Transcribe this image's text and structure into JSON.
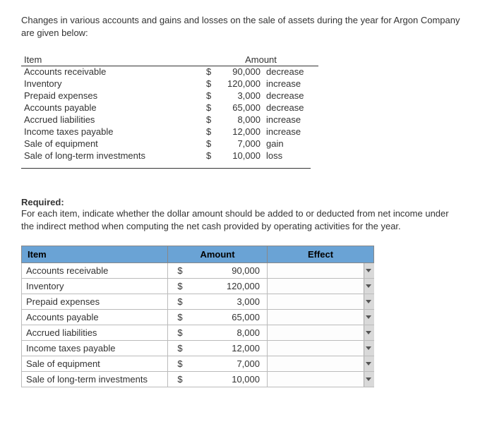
{
  "intro": "Changes in various accounts and gains and losses on the sale of assets during the year for Argon Company are given below:",
  "given": {
    "headers": {
      "item": "Item",
      "amount": "Amount"
    },
    "rows": [
      {
        "item": "Accounts receivable",
        "sign": "$",
        "value": "90,000",
        "direction": "decrease"
      },
      {
        "item": "Inventory",
        "sign": "$",
        "value": "120,000",
        "direction": "increase"
      },
      {
        "item": "Prepaid expenses",
        "sign": "$",
        "value": "3,000",
        "direction": "decrease"
      },
      {
        "item": "Accounts payable",
        "sign": "$",
        "value": "65,000",
        "direction": "decrease"
      },
      {
        "item": "Accrued liabilities",
        "sign": "$",
        "value": "8,000",
        "direction": "increase"
      },
      {
        "item": "Income taxes payable",
        "sign": "$",
        "value": "12,000",
        "direction": "increase"
      },
      {
        "item": "Sale of equipment",
        "sign": "$",
        "value": "7,000",
        "direction": "gain"
      },
      {
        "item": "Sale of long-term investments",
        "sign": "$",
        "value": "10,000",
        "direction": "loss"
      }
    ]
  },
  "required": {
    "heading": "Required:",
    "text": "For each item, indicate whether the dollar amount should be added to or deducted from net income under the indirect method when computing the net cash provided by operating activities for the year."
  },
  "answer": {
    "headers": {
      "item": "Item",
      "amount": "Amount",
      "effect": "Effect"
    },
    "rows": [
      {
        "item": "Accounts receivable",
        "sign": "$",
        "value": "90,000",
        "effect": ""
      },
      {
        "item": "Inventory",
        "sign": "$",
        "value": "120,000",
        "effect": ""
      },
      {
        "item": "Prepaid expenses",
        "sign": "$",
        "value": "3,000",
        "effect": ""
      },
      {
        "item": "Accounts payable",
        "sign": "$",
        "value": "65,000",
        "effect": ""
      },
      {
        "item": "Accrued liabilities",
        "sign": "$",
        "value": "8,000",
        "effect": ""
      },
      {
        "item": "Income taxes payable",
        "sign": "$",
        "value": "12,000",
        "effect": ""
      },
      {
        "item": "Sale of equipment",
        "sign": "$",
        "value": "7,000",
        "effect": ""
      },
      {
        "item": "Sale of long-term investments",
        "sign": "$",
        "value": "10,000",
        "effect": ""
      }
    ]
  }
}
